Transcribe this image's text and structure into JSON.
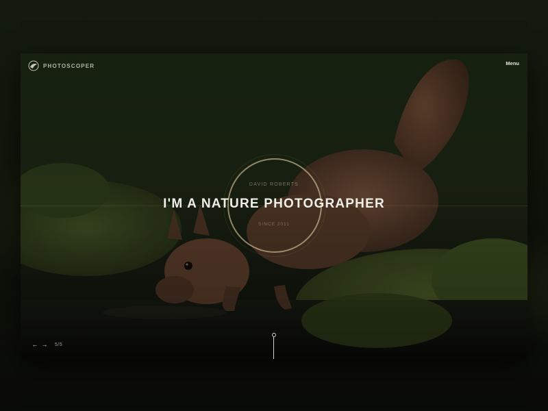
{
  "brand": {
    "name": "PHOTOSCOPER",
    "logo_icon": "bird-logo-icon"
  },
  "header": {
    "menu_label": "Menu"
  },
  "hero": {
    "kicker": "DAVID ROBERTS",
    "headline": "I'M A NATURE PHOTOGRAPHER",
    "since": "SINCE 2011"
  },
  "slider": {
    "prev_icon": "arrow-left-icon",
    "next_icon": "arrow-right-icon",
    "prev_glyph": "←",
    "next_glyph": "→",
    "counter": "5/5"
  },
  "scroll_indicator": {
    "icon": "scroll-down-indicator"
  },
  "colors": {
    "accent_ring": "#d2be96",
    "text_primary": "#f1eee8",
    "background": "#1a1d14"
  }
}
